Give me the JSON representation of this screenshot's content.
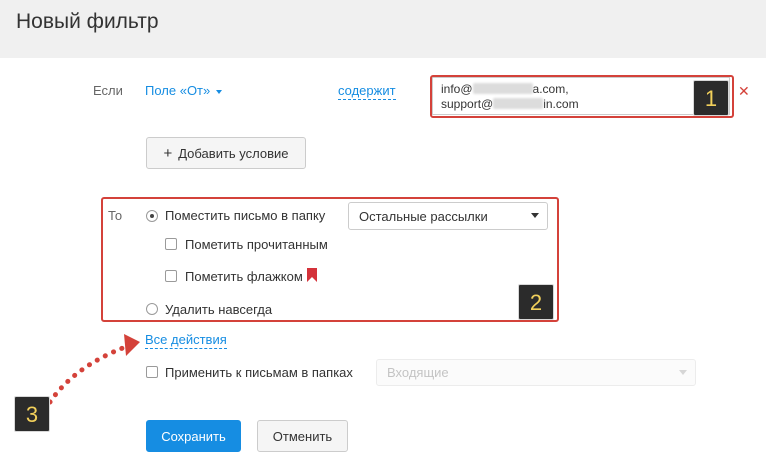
{
  "page": {
    "title": "Новый фильтр"
  },
  "condition": {
    "if_label": "Если",
    "field_label": "Поле «От»",
    "operator_label": "содержит",
    "value_line1_prefix": "info@",
    "value_line1_suffix": "a.com,",
    "value_line2_prefix": "support@",
    "value_line2_suffix": "in.com",
    "add_condition_label": "Добавить условие",
    "add_icon": "plus-icon"
  },
  "actions": {
    "then_label": "То",
    "move_label": "Поместить письмо в папку",
    "move_selected": true,
    "folder_selected": "Остальные рассылки",
    "mark_read_label": "Пометить прочитанным",
    "mark_read_checked": false,
    "mark_flag_label": "Пометить флажком",
    "mark_flag_checked": false,
    "flag_icon": "bookmark-flag-icon",
    "flag_color": "#d4323a",
    "delete_label": "Удалить навсегда",
    "delete_selected": false,
    "all_actions_label": "Все действия"
  },
  "apply": {
    "label": "Применить к письмам в папках",
    "checked": false,
    "folder_placeholder": "Входящие"
  },
  "buttons": {
    "save_label": "Сохранить",
    "cancel_label": "Отменить"
  },
  "annotations": {
    "badge1": "1",
    "badge2": "2",
    "badge3": "3",
    "frame_color": "#d4423a",
    "badge_text_color": "#f2d05b"
  },
  "colors": {
    "accent": "#168de2",
    "header_bg": "#f0f0f0"
  }
}
